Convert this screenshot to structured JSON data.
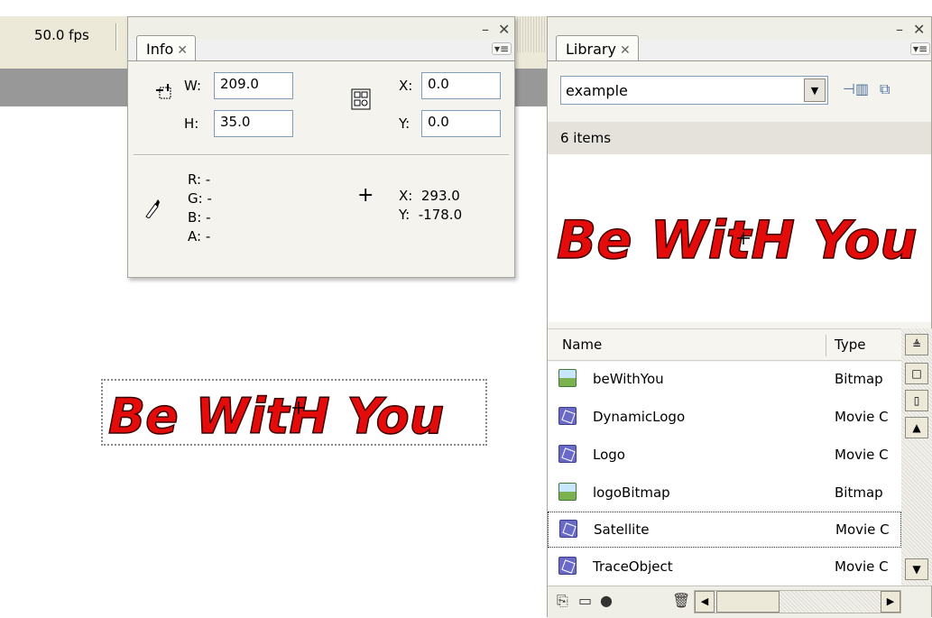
{
  "timeline": {
    "fps": "50.0 fps"
  },
  "colors": {
    "logo_red": "#e40b0b",
    "panel_bg": "#f4f3ee",
    "band_gray": "#989898"
  },
  "info_panel": {
    "tab_label": "Info",
    "width_label": "W:",
    "width_value": "209.0",
    "height_label": "H:",
    "height_value": "35.0",
    "x_label": "X:",
    "x_value": "0.0",
    "y_label": "Y:",
    "y_value": "0.0",
    "r_label": "R: -",
    "g_label": "G: -",
    "b_label": "B: -",
    "a_label": "A: -",
    "cursor_x": "X:  293.0",
    "cursor_y": "Y:  -178.0"
  },
  "library_panel": {
    "tab_label": "Library",
    "document": "example",
    "item_count": "6 items",
    "preview_text": "Be WitH You",
    "columns": {
      "name": "Name",
      "type": "Type"
    },
    "items": [
      {
        "name": "beWithYou",
        "type": "Bitmap",
        "icon": "bitmap-icon"
      },
      {
        "name": "DynamicLogo",
        "type": "Movie C",
        "icon": "movieclip-icon"
      },
      {
        "name": "Logo",
        "type": "Movie C",
        "icon": "movieclip-icon"
      },
      {
        "name": "logoBitmap",
        "type": "Bitmap",
        "icon": "bitmap-icon"
      },
      {
        "name": "Satellite",
        "type": "Movie C",
        "icon": "movieclip-icon"
      },
      {
        "name": "TraceObject",
        "type": "Movie C",
        "icon": "movieclip-icon"
      }
    ]
  },
  "stage": {
    "logo_text": "Be WitH You"
  }
}
